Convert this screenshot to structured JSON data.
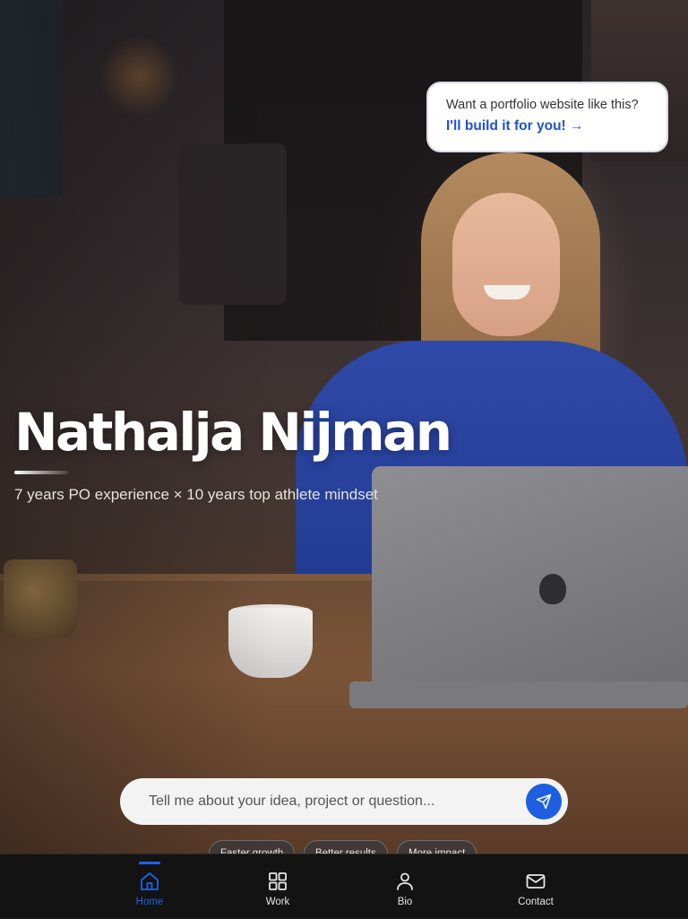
{
  "promo": {
    "question": "Want a portfolio website like this?",
    "cta": "I'll build it for you! →"
  },
  "hero": {
    "name": "Nathalja Nijman",
    "tagline": "7 years PO experience × 10 years top athlete mindset"
  },
  "chat": {
    "placeholder": "Tell me about your idea, project or question...",
    "send_icon": "paper-plane-icon"
  },
  "chips": [
    "Faster growth",
    "Better results",
    "More impact"
  ],
  "nav": {
    "active": "Home",
    "items": [
      {
        "label": "Home",
        "icon": "home-icon"
      },
      {
        "label": "Work",
        "icon": "grid-icon"
      },
      {
        "label": "Bio",
        "icon": "user-icon"
      },
      {
        "label": "Contact",
        "icon": "mail-icon"
      }
    ]
  },
  "colors": {
    "accent": "#1f63e6",
    "promo_link": "#1f52c9",
    "nav_background": "#131313"
  }
}
